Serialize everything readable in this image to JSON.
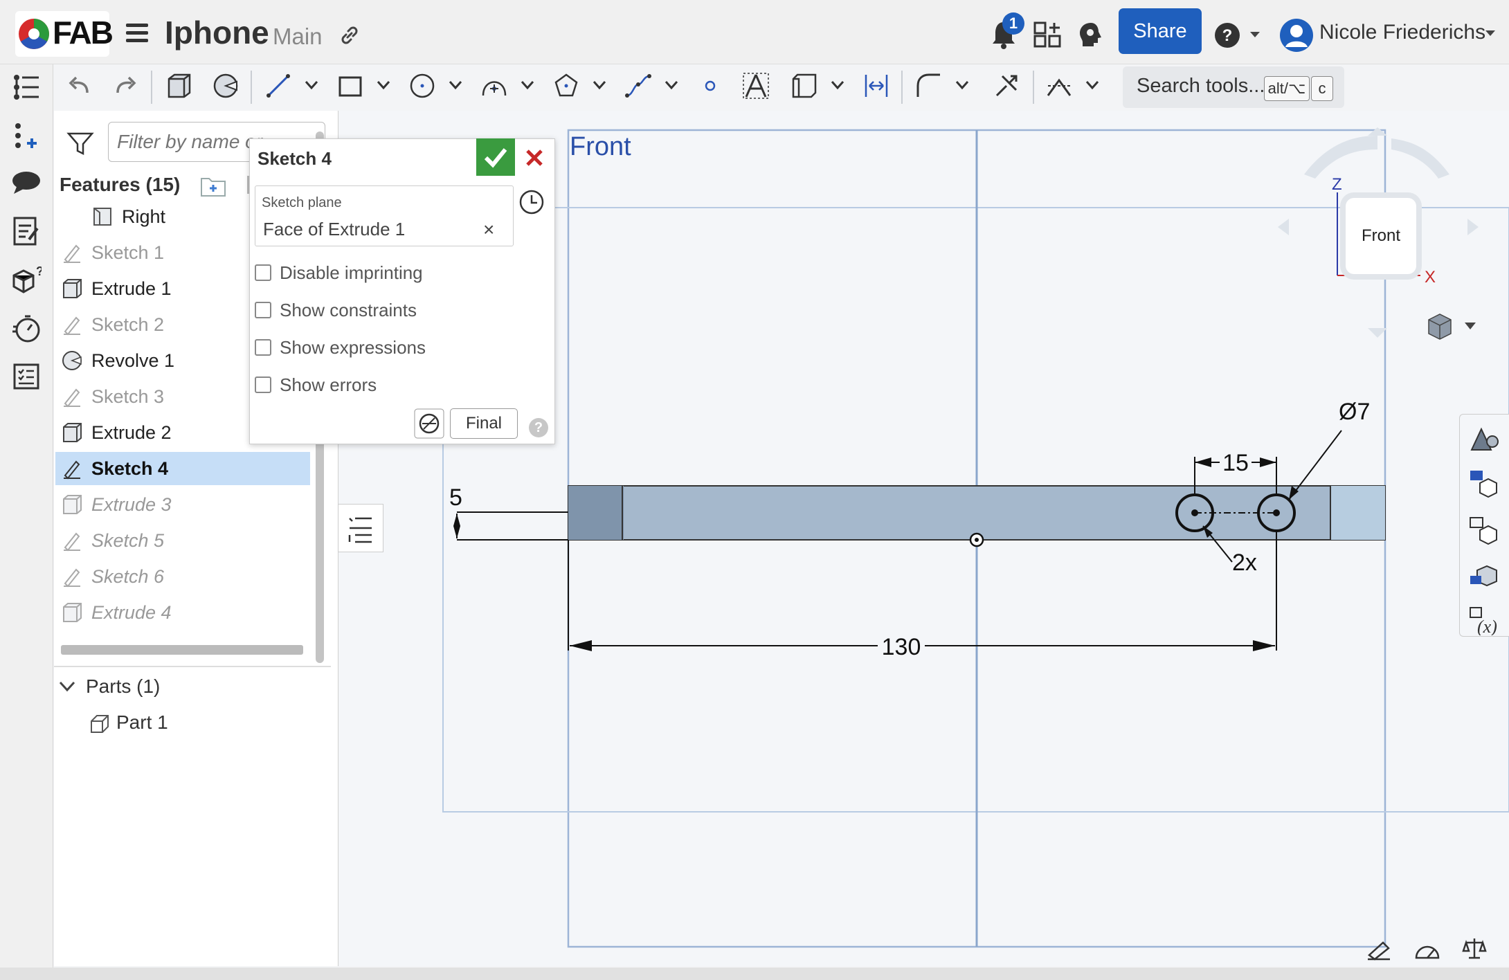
{
  "topbar": {
    "logo_text": "FAB",
    "document_title": "Iphone",
    "branch": "Main",
    "notification_count": "1",
    "share_label": "Share",
    "user_name": "Nicole Friederichs"
  },
  "toolbar": {
    "search_placeholder": "Search tools...",
    "shortcut_modifier": "alt/⌥",
    "shortcut_key": "c"
  },
  "features": {
    "filter_placeholder": "Filter by name or",
    "header": "Features (15)",
    "items": [
      {
        "label": "Right",
        "state": "normal"
      },
      {
        "label": "Sketch 1",
        "state": "suppressed"
      },
      {
        "label": "Extrude 1",
        "state": "normal"
      },
      {
        "label": "Sketch 2",
        "state": "suppressed"
      },
      {
        "label": "Revolve 1",
        "state": "normal"
      },
      {
        "label": "Sketch 3",
        "state": "suppressed"
      },
      {
        "label": "Extrude 2",
        "state": "normal"
      },
      {
        "label": "Sketch 4",
        "state": "selected"
      },
      {
        "label": "Extrude 3",
        "state": "rolled-back"
      },
      {
        "label": "Sketch 5",
        "state": "rolled-back"
      },
      {
        "label": "Sketch 6",
        "state": "rolled-back"
      },
      {
        "label": "Extrude 4",
        "state": "rolled-back"
      }
    ],
    "parts_header": "Parts (1)",
    "parts": [
      "Part 1"
    ]
  },
  "sketch_dialog": {
    "title": "Sketch 4",
    "plane_label": "Sketch plane",
    "plane_value": "Face of Extrude 1",
    "options": [
      {
        "label": "Disable imprinting",
        "checked": false
      },
      {
        "label": "Show constraints",
        "checked": false
      },
      {
        "label": "Show expressions",
        "checked": false
      },
      {
        "label": "Show errors",
        "checked": false
      }
    ],
    "final_label": "Final"
  },
  "viewport": {
    "plane_label": "Front",
    "viewcube_face": "Front",
    "axis_z": "Z",
    "axis_x": "X",
    "dimensions": {
      "height": "5",
      "spacing": "15",
      "diameter": "Ø7",
      "count": "2x",
      "length": "130"
    }
  },
  "colors": {
    "accent": "#1f5fbd",
    "confirm": "#3a9b3f",
    "cancel": "#c62828",
    "selection": "#c6def7",
    "plane_label": "#2a4fa8"
  }
}
